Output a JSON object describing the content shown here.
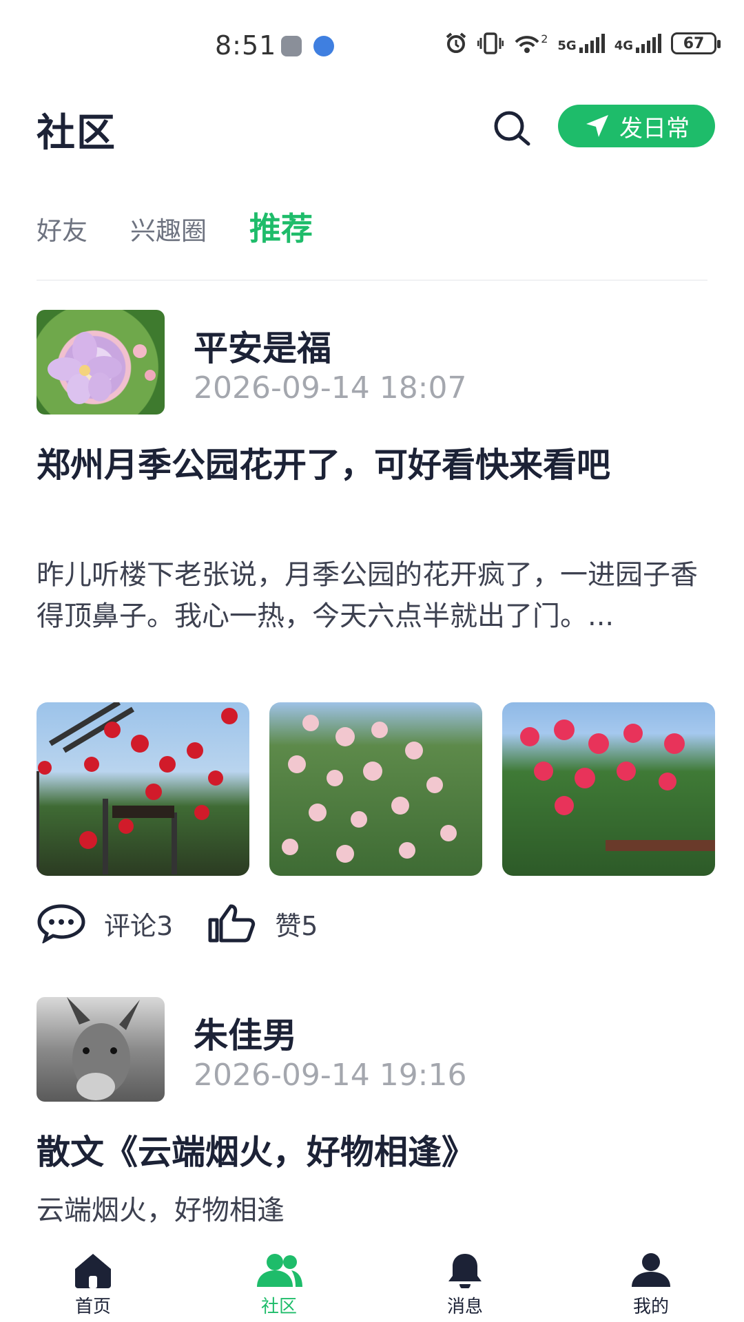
{
  "status_bar": {
    "time": "8:51",
    "network_5g": "5G",
    "network_4g": "4G",
    "wifi_badge": "2",
    "battery": "67"
  },
  "header": {
    "title": "社区",
    "post_button_label": "发日常"
  },
  "tabs": [
    {
      "label": "好友",
      "active": false
    },
    {
      "label": "兴趣圈",
      "active": false
    },
    {
      "label": "推荐",
      "active": true
    }
  ],
  "posts": [
    {
      "author": "平安是福",
      "time": "2026-09-14 18:07",
      "title": "郑州月季公园花开了，可好看快来看吧",
      "body": "昨儿听楼下老张说，月季公园的花开疯了，一进园子香得顶鼻子。我心一热，今天六点半就出了门。...",
      "comments_label": "评论3",
      "likes_label": "赞5",
      "photos": [
        "red-roses-arch-photo",
        "pink-roses-bush-photo",
        "hot-pink-roses-photo"
      ]
    },
    {
      "author": "朱佳男",
      "time": "2026-09-14 19:16",
      "title": "散文《云端烟火，好物相逢》",
      "body": "云端烟火，好物相逢"
    }
  ],
  "bottom_nav": [
    {
      "label": "首页",
      "icon": "home-icon",
      "active": false
    },
    {
      "label": "社区",
      "icon": "community-icon",
      "active": true
    },
    {
      "label": "消息",
      "icon": "bell-icon",
      "active": false
    },
    {
      "label": "我的",
      "icon": "user-icon",
      "active": false
    }
  ],
  "colors": {
    "accent": "#1ebc6a",
    "text_primary": "#1c2236",
    "text_secondary": "#a4a7ae"
  }
}
